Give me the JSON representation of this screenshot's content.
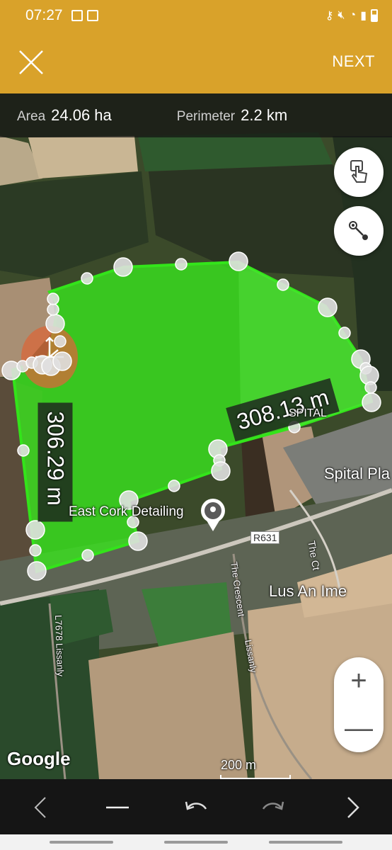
{
  "status_bar": {
    "time": "07:27",
    "icons": [
      "image-icon",
      "gallery-icon",
      "key-icon",
      "mute-icon",
      "wifi-icon",
      "signal-icon",
      "battery-icon"
    ]
  },
  "app_bar": {
    "next_label": "NEXT",
    "background": "#d9a22a"
  },
  "measurements": {
    "area_label": "Area",
    "area_value": "24.06 ha",
    "perimeter_label": "Perimeter",
    "perimeter_value": "2.2 km"
  },
  "map": {
    "segment_labels": {
      "left": "306.29 m",
      "right": "308.13 m"
    },
    "place_labels": {
      "poi": "East Cork Detailing",
      "spital": "SPITAL",
      "spital_place": "Spital Pla",
      "lus_an_ime": "Lus An Ime",
      "road_r631": "R631",
      "the_ct": "The Ct",
      "the_crescent": "The Crescent",
      "lissanly": "Lissanly",
      "l7678": "L7678 Lissanly"
    },
    "scale_label": "200 m",
    "attribution": "Google",
    "polygon_fill": "#39e21f",
    "accent": "#d9a22a"
  },
  "buttons": {
    "touch_mode": "touch-hand-icon",
    "point_mode": "point-to-point-icon",
    "zoom_in": "+",
    "zoom_out": "—"
  },
  "toolbar": {
    "icons": [
      "chevron-left-icon",
      "minus-icon",
      "undo-icon",
      "redo-icon",
      "chevron-right-icon"
    ]
  }
}
